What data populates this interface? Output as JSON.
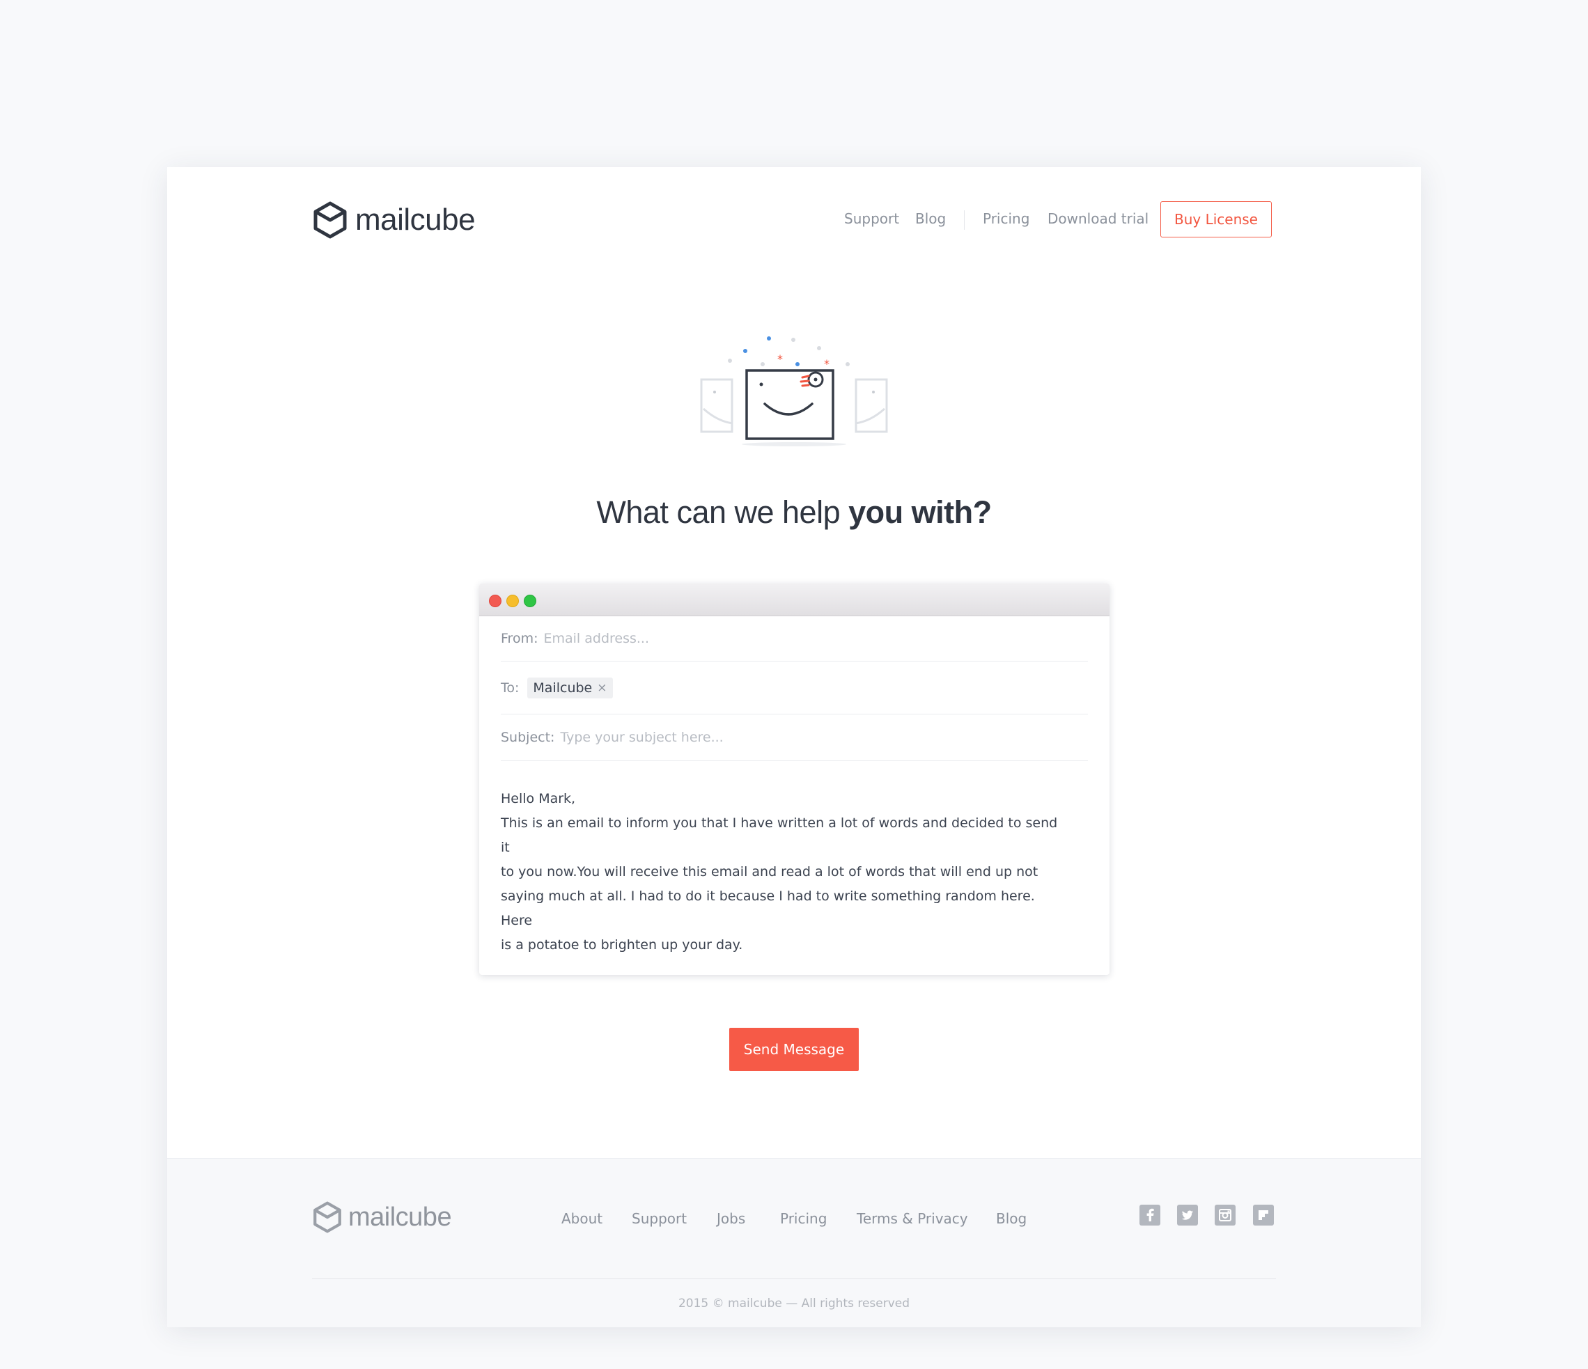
{
  "brand": {
    "name": "mailcube"
  },
  "header": {
    "nav": [
      "Support",
      "Blog",
      "Pricing",
      "Download trial"
    ],
    "buy_label": "Buy License"
  },
  "hero": {
    "headline_light": "What can we help ",
    "headline_bold": "you with?"
  },
  "compose": {
    "from_label": "From:",
    "from_placeholder": "Email address...",
    "to_label": "To:",
    "to_chip": "Mailcube",
    "to_chip_remove": "×",
    "subject_label": "Subject:",
    "subject_placeholder": "Type your subject here...",
    "body_lines": [
      "Hello Mark,",
      "This is an email to inform you that I have written a lot of words and decided to send it",
      "to you now.You will receive this email and read a lot of words that will end up not",
      "saying much at all. I had to do it because I had to write something random here. Here",
      "is a potatoe to brighten up your day."
    ]
  },
  "send_label": "Send Message",
  "footer": {
    "nav": [
      "About",
      "Support",
      "Jobs",
      "Pricing",
      "Terms & Privacy",
      "Blog"
    ],
    "social_icons": [
      "facebook-icon",
      "twitter-icon",
      "instagram-icon",
      "flipboard-icon"
    ],
    "copyright": "2015 © mailcube — All rights reserved"
  },
  "colors": {
    "accent": "#f65a47",
    "text_dark": "#2f3540",
    "text_muted": "#8b919b",
    "page_bg": "#f8f9fb",
    "traffic_red": "#f25a52",
    "traffic_yellow": "#f6bd2c",
    "traffic_green": "#2fc545"
  }
}
